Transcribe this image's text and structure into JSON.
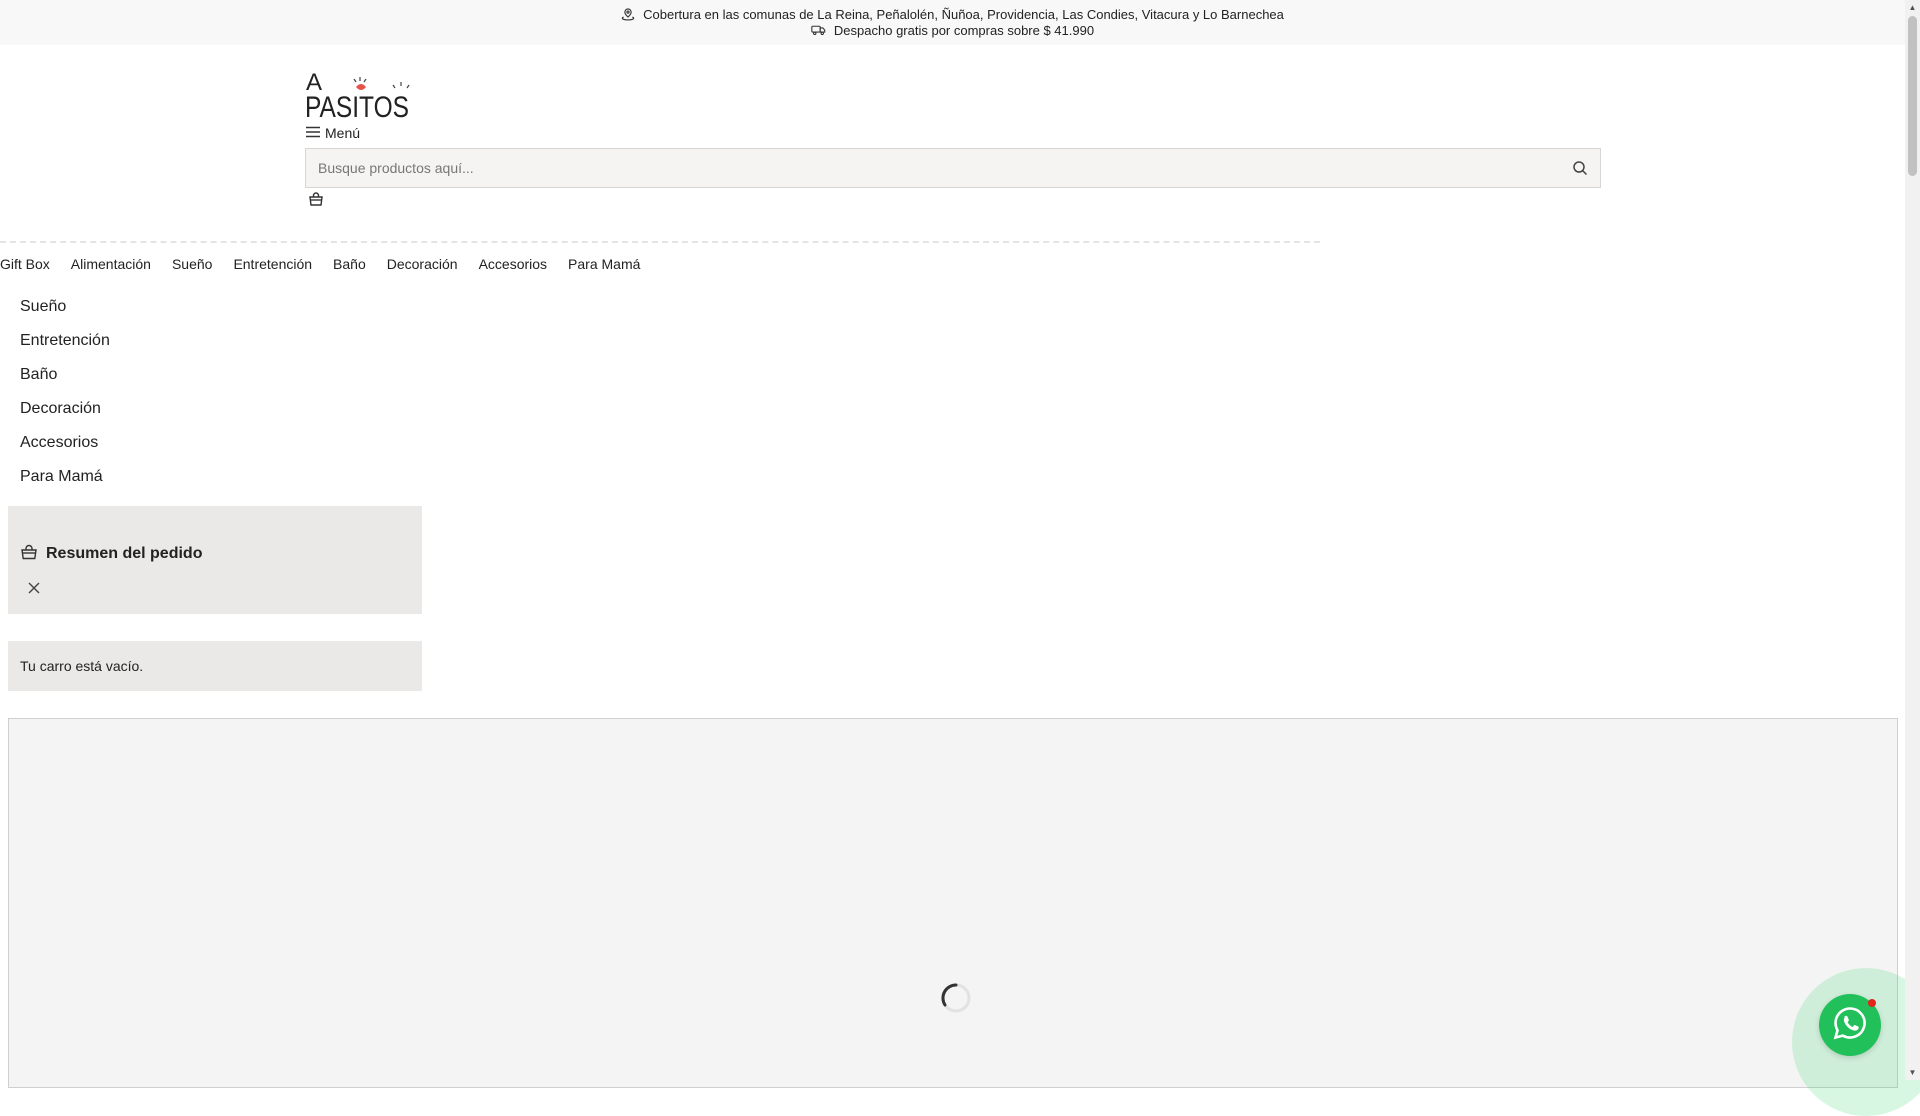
{
  "topbar": {
    "coverage_text": "Cobertura en las comunas de La Reina, Peñalolén, Ñuñoa, Providencia, Las Condies, Vitacura y Lo Barnechea",
    "shipping_text": "Despacho gratis por compras sobre $ 41.990",
    "coverage_icon": "location-icon",
    "shipping_icon": "truck-icon"
  },
  "header": {
    "logo_top": "A",
    "logo_bottom": "PASITOS",
    "menu_label": "Menú",
    "search_placeholder": "Busque productos aquí...",
    "search_value": ""
  },
  "nav": {
    "items": [
      "Gift Box",
      "Alimentación",
      "Sueño",
      "Entretención",
      "Baño",
      "Decoración",
      "Accesorios",
      "Para Mamá"
    ]
  },
  "side_list": {
    "items": [
      "Sueño",
      "Entretención",
      "Baño",
      "Decoración",
      "Accesorios",
      "Para Mamá"
    ]
  },
  "order_summary": {
    "title": "Resumen del pedido",
    "empty_text": "Tu carro está vacío."
  },
  "colors": {
    "whatsapp": "#22c05a",
    "badge": "#e0261d",
    "panel_bg": "#ebe9e7"
  }
}
